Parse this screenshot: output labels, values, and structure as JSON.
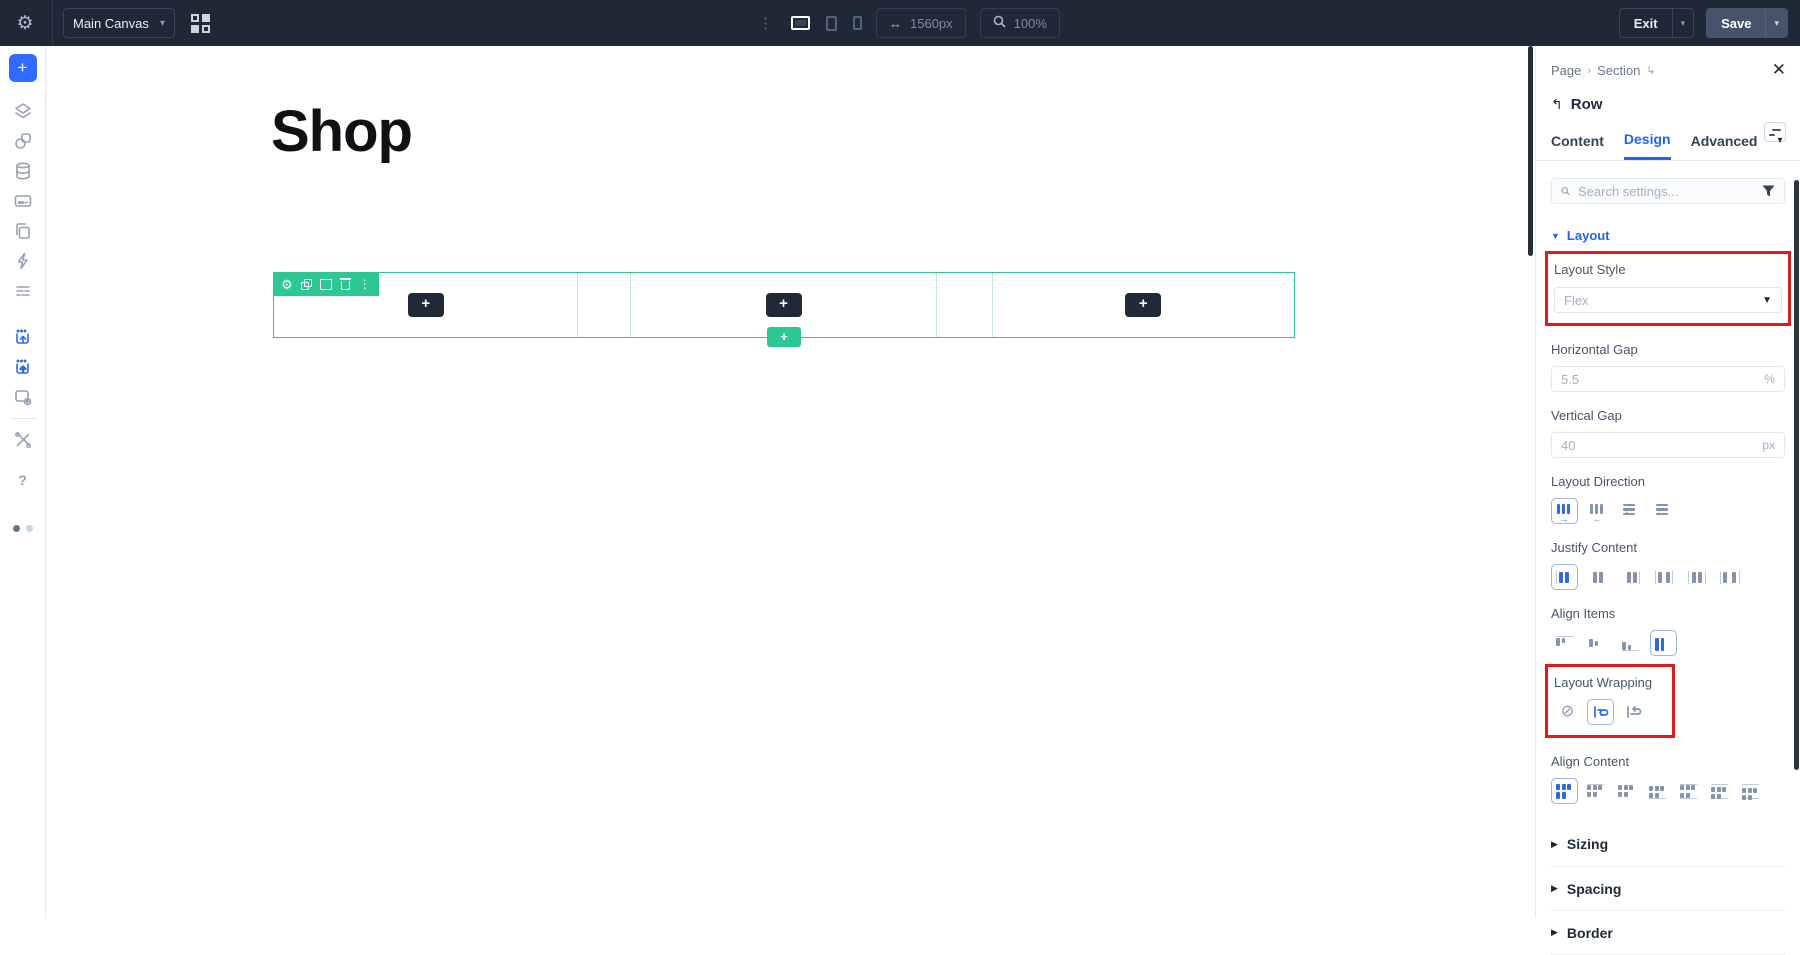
{
  "topbar": {
    "canvas_selector": "Main Canvas",
    "width_value": "1560px",
    "zoom_value": "100%",
    "exit_label": "Exit",
    "save_label": "Save",
    "icons": [
      "gear-icon",
      "grid-icon",
      "kebab-icon",
      "desktop-icon",
      "tablet-icon",
      "phone-icon",
      "width-icon",
      "zoom-icon"
    ]
  },
  "left_sidebar": {
    "icons": [
      "add-element-button",
      "layers-icon",
      "design-library-icon",
      "database-icon",
      "form-icon",
      "copy-pages-icon",
      "bolt-icon",
      "list-icon",
      "insert-mode-icon",
      "insert-mode-alt-icon",
      "window-settings-icon",
      "tools-icon",
      "help-icon"
    ]
  },
  "canvas": {
    "heading": "Shop",
    "row_toolbar_icons": [
      "gear-icon",
      "duplicate-icon",
      "columns-icon",
      "trash-icon",
      "kebab-icon"
    ],
    "add_element_label": "+",
    "add_row_label": "+",
    "accent_teal": "#2cc795"
  },
  "panel": {
    "breadcrumb": {
      "items": [
        "Page",
        "Section"
      ],
      "separator": "›",
      "tail_icon": "enter-arrow-icon"
    },
    "close_icon": "close-icon",
    "element": {
      "back_icon": "back-arrow-icon",
      "name": "Row",
      "preset_icon": "preset-icon"
    },
    "tabs": {
      "items": [
        "Content",
        "Design",
        "Advanced"
      ],
      "active": "Design"
    },
    "search": {
      "placeholder": "Search settings...",
      "icons": [
        "search-icon",
        "filter-funnel-icon"
      ]
    },
    "layout_section": {
      "label": "Layout"
    },
    "layout_style": {
      "label": "Layout Style",
      "value": "Flex",
      "highlighted": true
    },
    "horizontal_gap": {
      "label": "Horizontal Gap",
      "value": "5.5",
      "unit": "%"
    },
    "vertical_gap": {
      "label": "Vertical Gap",
      "value": "40",
      "unit": "px"
    },
    "layout_direction": {
      "label": "Layout Direction",
      "options": [
        "row",
        "row-reverse",
        "column",
        "column-reverse"
      ],
      "selected": 0
    },
    "justify_content": {
      "label": "Justify Content",
      "options": [
        "flex-start",
        "center",
        "flex-end",
        "space-between",
        "space-around",
        "space-evenly"
      ],
      "selected": 0
    },
    "align_items": {
      "label": "Align Items",
      "options": [
        "flex-start",
        "center",
        "flex-end",
        "stretch"
      ],
      "selected": 3
    },
    "layout_wrapping": {
      "label": "Layout Wrapping",
      "options": [
        "nowrap",
        "wrap",
        "wrap-reverse"
      ],
      "selected": 1,
      "highlighted": true
    },
    "align_content": {
      "label": "Align Content",
      "options": [
        "stretch",
        "flex-start",
        "center",
        "flex-end",
        "space-between",
        "space-around",
        "space-evenly"
      ],
      "selected": 0
    },
    "collapsed_sections": [
      "Sizing",
      "Spacing",
      "Border"
    ],
    "colors": {
      "accent_blue": "#2563eb",
      "highlight_red": "#e01b1b"
    }
  }
}
